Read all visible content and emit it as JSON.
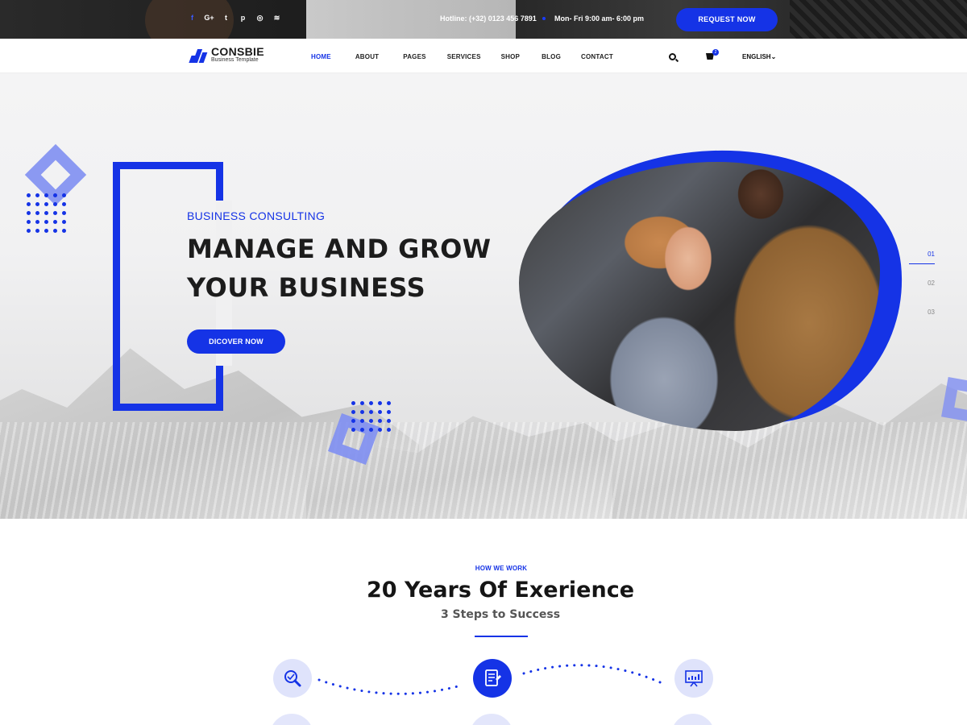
{
  "topbar": {
    "social": [
      "f",
      "G+",
      "t",
      "p",
      "◎",
      "≋"
    ],
    "hotline": "Hotline: (+32) 0123 456 7891",
    "hours": "Mon- Fri   9:00 am- 6:00 pm",
    "request_label": "REQUEST NOW"
  },
  "brand": {
    "name": "CONSBIE",
    "tagline": "Business Template"
  },
  "nav": {
    "items": [
      "HOME",
      "ABOUT",
      "PAGES",
      "SERVICES",
      "SHOP",
      "BLOG",
      "CONTACT"
    ],
    "active": "HOME",
    "cart_count": "2",
    "language": "ENGLISH"
  },
  "hero": {
    "kicker": "BUSINESS CONSULTING",
    "headline_line1": "MANAGE AND GROW",
    "headline_line2": "YOUR BUSINESS",
    "cta_label": "DICOVER NOW",
    "slides": [
      "01",
      "02",
      "03"
    ],
    "active_slide": "01"
  },
  "how_we_work": {
    "eyebrow": "HOW WE WORK",
    "title": "20 Years Of Exerience",
    "subtitle": "3 Steps to Success",
    "steps": [
      {
        "icon": "analysis-search-icon",
        "active": false
      },
      {
        "icon": "planning-document-icon",
        "active": true
      },
      {
        "icon": "growth-chart-icon",
        "active": false
      }
    ]
  },
  "colors": {
    "accent": "#1533e6",
    "accent_light": "#7f8ff2",
    "icon_bg": "#dfe3fb"
  }
}
